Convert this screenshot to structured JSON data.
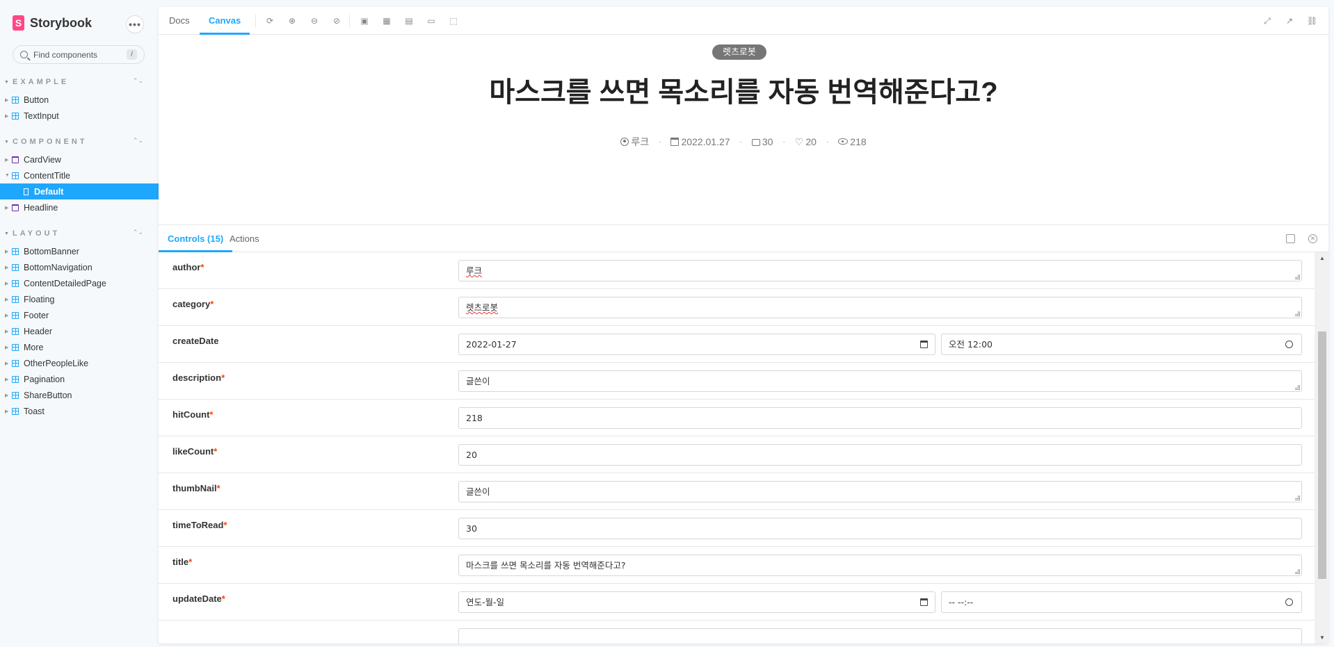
{
  "sidebar": {
    "brand": "Storybook",
    "brand_logo": "S",
    "more": "•••",
    "search_placeholder": "Find components",
    "search_shortcut": "/",
    "sections": [
      {
        "title": "EXAMPLE",
        "items": [
          "Button",
          "TextInput"
        ]
      },
      {
        "title": "COMPONENT",
        "items": [
          "CardView",
          "ContentTitle",
          "Headline"
        ],
        "selected_child": "Default"
      },
      {
        "title": "LAYOUT",
        "items": [
          "BottomBanner",
          "BottomNavigation",
          "ContentDetailedPage",
          "Floating",
          "Footer",
          "Header",
          "More",
          "OtherPeopleLike",
          "Pagination",
          "ShareButton",
          "Toast"
        ]
      }
    ]
  },
  "toolbar": {
    "tabs": [
      "Docs",
      "Canvas"
    ],
    "active_tab": "Canvas"
  },
  "preview": {
    "category": "렛츠로봇",
    "title": "마스크를 쓰면 목소리를 자동 번역해준다고?",
    "author": "루크",
    "date": "2022.01.27",
    "comments": "30",
    "likes": "20",
    "views": "218",
    "separator": "·"
  },
  "addons": {
    "tabs": [
      "Controls (15)",
      "Actions"
    ],
    "active_tab": "Controls (15)"
  },
  "controls": [
    {
      "name": "author",
      "required": true,
      "value": "루크",
      "type": "text"
    },
    {
      "name": "category",
      "required": true,
      "value": "렛츠로봇",
      "type": "text"
    },
    {
      "name": "createDate",
      "required": false,
      "date": "2022-01-27",
      "time": "오전 12:00",
      "type": "datetime"
    },
    {
      "name": "description",
      "required": true,
      "value": "글쓴이",
      "type": "text"
    },
    {
      "name": "hitCount",
      "required": true,
      "value": "218",
      "type": "number"
    },
    {
      "name": "likeCount",
      "required": true,
      "value": "20",
      "type": "number"
    },
    {
      "name": "thumbNail",
      "required": true,
      "value": "글쓴이",
      "type": "text"
    },
    {
      "name": "timeToRead",
      "required": true,
      "value": "30",
      "type": "number"
    },
    {
      "name": "title",
      "required": true,
      "value": "마스크를 쓰면 목소리를 자동 번역해준다고?",
      "type": "text"
    },
    {
      "name": "updateDate",
      "required": true,
      "date": "연도-월-일",
      "time": "-- --:--",
      "type": "datetime"
    }
  ],
  "required_marker": "*",
  "colors": {
    "accent": "#1ea7fd",
    "brand": "#ff4785",
    "required": "#ff4400",
    "badge": "#767676"
  }
}
